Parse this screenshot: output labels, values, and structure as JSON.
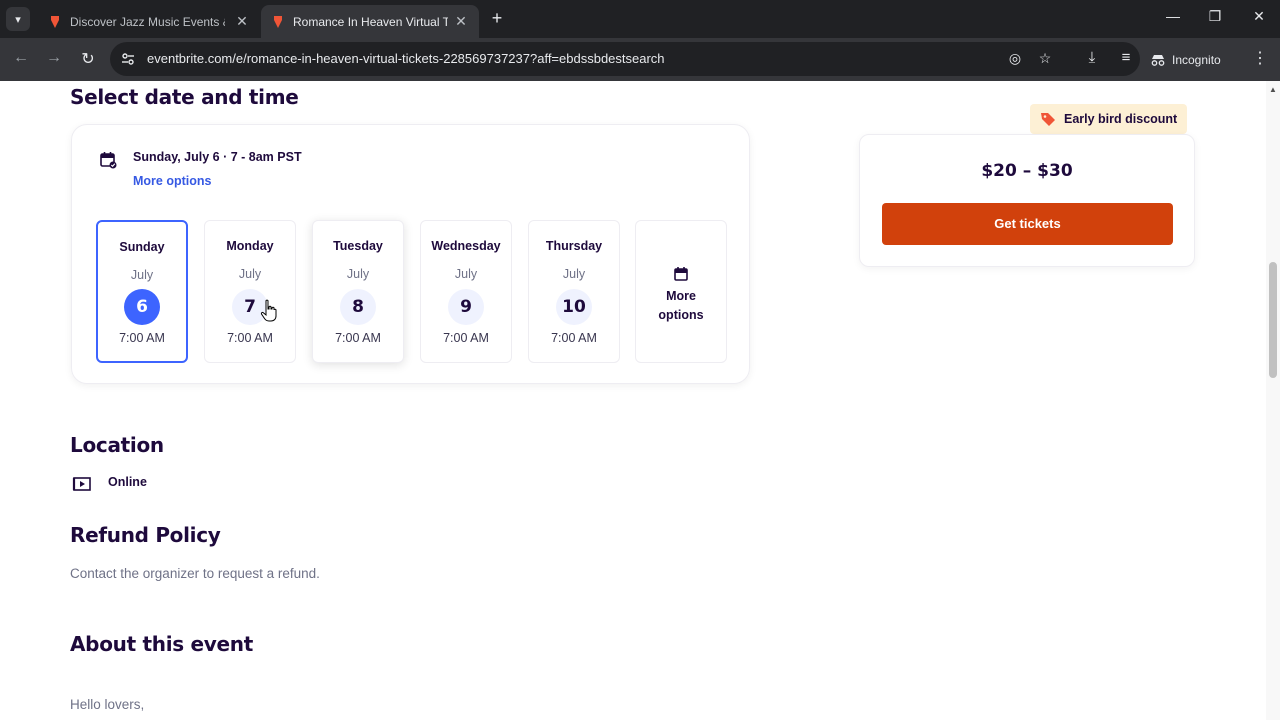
{
  "browser": {
    "tabs": [
      {
        "title": "Discover Jazz Music Events & A",
        "active": false
      },
      {
        "title": "Romance In Heaven Virtual Tick",
        "active": true
      }
    ],
    "url": "eventbrite.com/e/romance-in-heaven-virtual-tickets-228569737237?aff=ebdssbdestsearch",
    "profile_label": "Incognito"
  },
  "page": {
    "select_heading": "Select date and time",
    "selected_datetime": "Sunday, July 6 · 7 - 8am PST",
    "more_options_link": "More options",
    "days": [
      {
        "day": "Sunday",
        "month": "July",
        "date": "6",
        "time": "7:00 AM",
        "selected": true
      },
      {
        "day": "Monday",
        "month": "July",
        "date": "7",
        "time": "7:00 AM",
        "selected": false
      },
      {
        "day": "Tuesday",
        "month": "July",
        "date": "8",
        "time": "7:00 AM",
        "selected": false
      },
      {
        "day": "Wednesday",
        "month": "July",
        "date": "9",
        "time": "7:00 AM",
        "selected": false
      },
      {
        "day": "Thursday",
        "month": "July",
        "date": "10",
        "time": "7:00 AM",
        "selected": false
      }
    ],
    "more_options_tile_line1": "More",
    "more_options_tile_line2": "options",
    "badge": "Early bird discount",
    "price": "$20 – $30",
    "get_tickets": "Get tickets",
    "location_heading": "Location",
    "location_value": "Online",
    "refund_heading": "Refund Policy",
    "refund_text": "Contact the organizer to request a refund.",
    "about_heading": "About this event",
    "about_first_line": "Hello lovers,"
  },
  "colors": {
    "accent_blue": "#3d64ff",
    "cta_orange": "#d1410c",
    "heading": "#1e0a3c",
    "badge_bg": "#fdf0d5"
  }
}
